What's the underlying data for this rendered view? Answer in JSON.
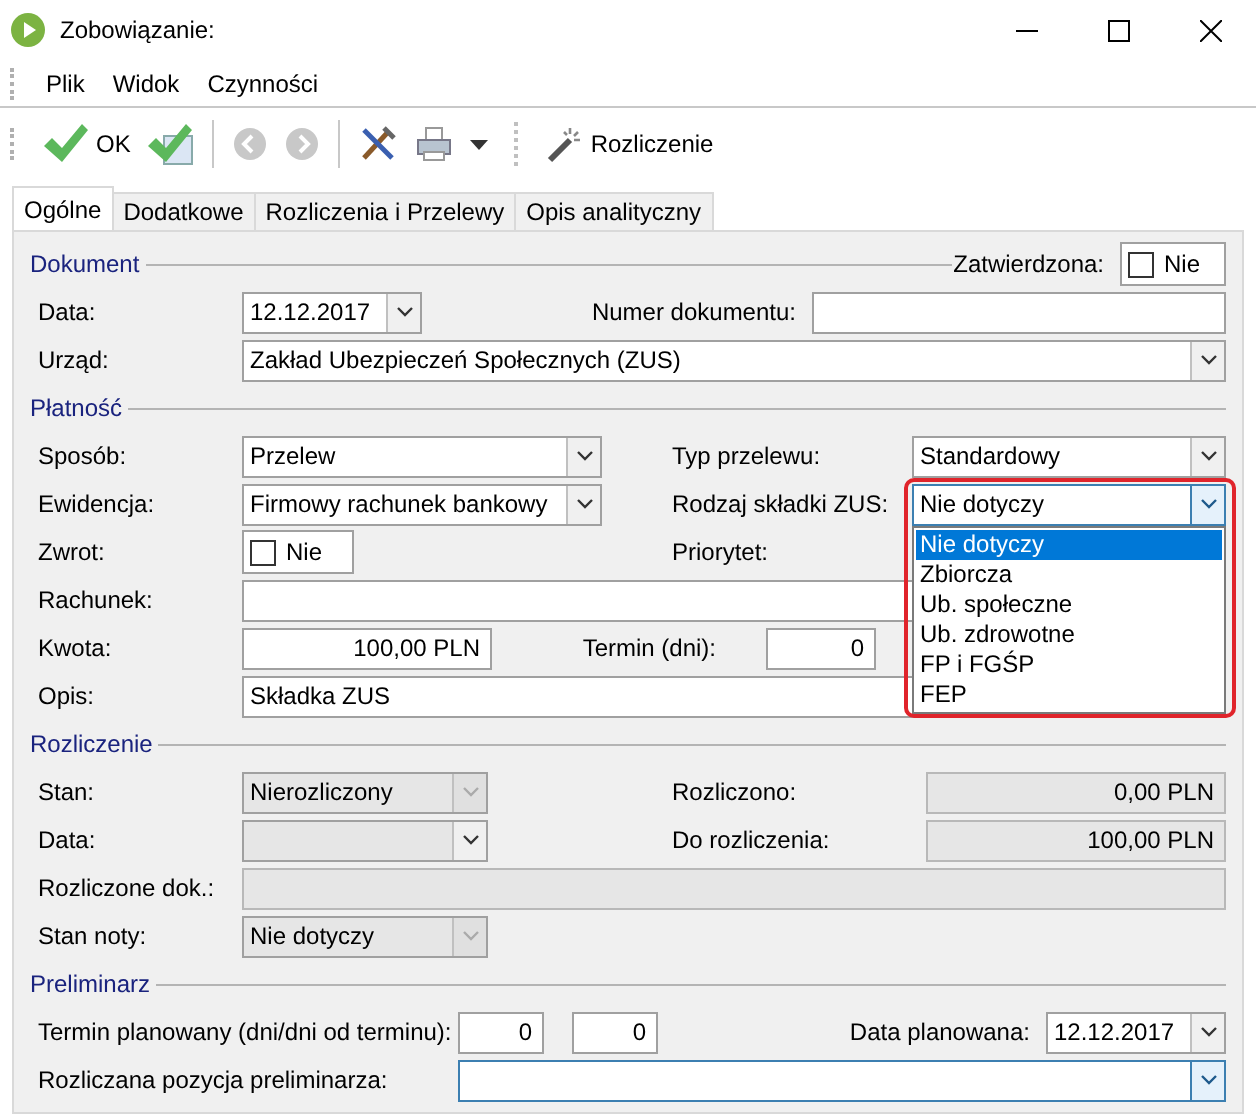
{
  "window": {
    "title": "Zobowiązanie:"
  },
  "menu": [
    "Plik",
    "Widok",
    "Czynności"
  ],
  "toolbar": [
    {
      "kind": "ok",
      "label": "OK",
      "disabled": false
    },
    {
      "kind": "ok-doc",
      "disabled": false
    },
    {
      "kind": "back",
      "disabled": true
    },
    {
      "kind": "forward",
      "disabled": true
    },
    {
      "kind": "tools",
      "disabled": false
    },
    {
      "kind": "print",
      "disabled": false
    },
    {
      "kind": "caret",
      "disabled": false
    },
    {
      "kind": "wand",
      "label": "Rozliczenie",
      "disabled": false
    }
  ],
  "tabs": [
    {
      "label": "Ogólne",
      "selected": true
    },
    {
      "label": "Dodatkowe",
      "selected": false
    },
    {
      "label": "Rozliczenia i Przelewy",
      "selected": false
    },
    {
      "label": "Opis analityczny",
      "selected": false
    }
  ],
  "dokument": {
    "title": "Dokument",
    "approved": {
      "label": "Zatwierdzona:",
      "value": "Nie",
      "checked": false
    },
    "date": {
      "label": "Data:",
      "value": "12.12.2017"
    },
    "number": {
      "label": "Numer dokumentu:"
    },
    "office": {
      "label": "Urząd:",
      "value": "Zakład Ubezpieczeń Społecznych (ZUS)"
    }
  },
  "platnosc": {
    "title": "Płatność",
    "method": {
      "label": "Sposób:",
      "value": "Przelew"
    },
    "transfer_type": {
      "label": "Typ przelewu:",
      "value": "Standardowy"
    },
    "register": {
      "label": "Ewidencja:",
      "value": "Firmowy rachunek bankowy"
    },
    "zus_type": {
      "label": "Rodzaj składki ZUS:",
      "value": "Nie dotyczy",
      "expanded": true,
      "options": [
        {
          "label": "Nie dotyczy",
          "selected": true
        },
        {
          "label": "Zbiorcza",
          "selected": false
        },
        {
          "label": "Ub. społeczne",
          "selected": false
        },
        {
          "label": "Ub. zdrowotne",
          "selected": false
        },
        {
          "label": "FP i FGŚP",
          "selected": false
        },
        {
          "label": "FEP",
          "selected": false
        }
      ]
    },
    "refund": {
      "label": "Zwrot:",
      "value": "Nie",
      "checked": false
    },
    "priority": {
      "label": "Priorytet:"
    },
    "account": {
      "label": "Rachunek:"
    },
    "amount": {
      "label": "Kwota:",
      "value": "100,00 PLN"
    },
    "term": {
      "label": "Termin (dni):",
      "value": "0"
    },
    "description": {
      "label": "Opis:",
      "value": "Składka ZUS"
    }
  },
  "rozliczenie": {
    "title": "Rozliczenie",
    "state": {
      "label": "Stan:",
      "value": "Nierozliczony",
      "disabled": true
    },
    "settled": {
      "label": "Rozliczono:",
      "value": "0,00 PLN"
    },
    "date": {
      "label": "Data:",
      "disabled": false
    },
    "to_settle": {
      "label": "Do rozliczenia:",
      "value": "100,00 PLN"
    },
    "settled_docs": {
      "label": "Rozliczone dok.:"
    },
    "note_state": {
      "label": "Stan noty:",
      "value": "Nie dotyczy",
      "disabled": true
    }
  },
  "preliminarz": {
    "title": "Preliminarz",
    "planned_term": {
      "label": "Termin planowany (dni/dni od terminu):",
      "days": "0",
      "days_from_term": "0"
    },
    "planned_date": {
      "label": "Data planowana:",
      "value": "12.12.2017"
    },
    "position": {
      "label": "Rozliczana pozycja preliminarza:"
    }
  }
}
